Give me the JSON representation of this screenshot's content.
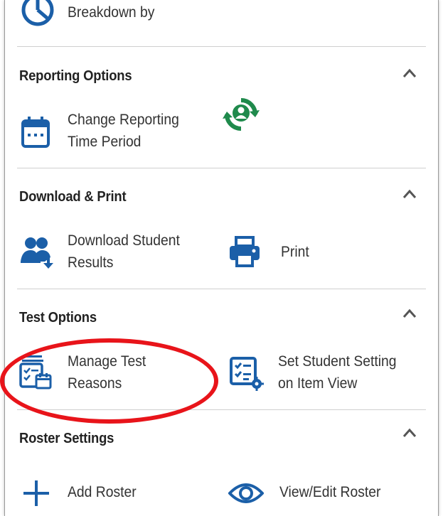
{
  "top_item": {
    "label": "Breakdown by"
  },
  "sections": {
    "reporting": {
      "title": "Reporting Options",
      "items": [
        {
          "label_line1": "Change Reporting",
          "label_line2": "Time Period",
          "icon": "calendar-icon"
        }
      ],
      "extra_icon": "sync-user-icon"
    },
    "download": {
      "title": "Download & Print",
      "items": [
        {
          "label_line1": "Download Student",
          "label_line2": "Results",
          "icon": "download-users-icon"
        },
        {
          "label": "Print",
          "icon": "printer-icon"
        }
      ]
    },
    "test_options": {
      "title": "Test Options",
      "items": [
        {
          "label_line1": "Manage Test",
          "label_line2": "Reasons",
          "icon": "manage-reasons-icon"
        },
        {
          "label_line1": "Set Student Setting",
          "label_line2": "on Item View",
          "icon": "checklist-settings-icon"
        }
      ]
    },
    "roster": {
      "title": "Roster Settings",
      "items": [
        {
          "label": "Add Roster",
          "icon": "plus-icon"
        },
        {
          "label": "View/Edit Roster",
          "icon": "eye-icon"
        }
      ]
    }
  },
  "colors": {
    "icon_blue": "#1b5fa8",
    "icon_green": "#1f8a4c",
    "highlight_red": "#e8141a",
    "text": "#333333"
  }
}
